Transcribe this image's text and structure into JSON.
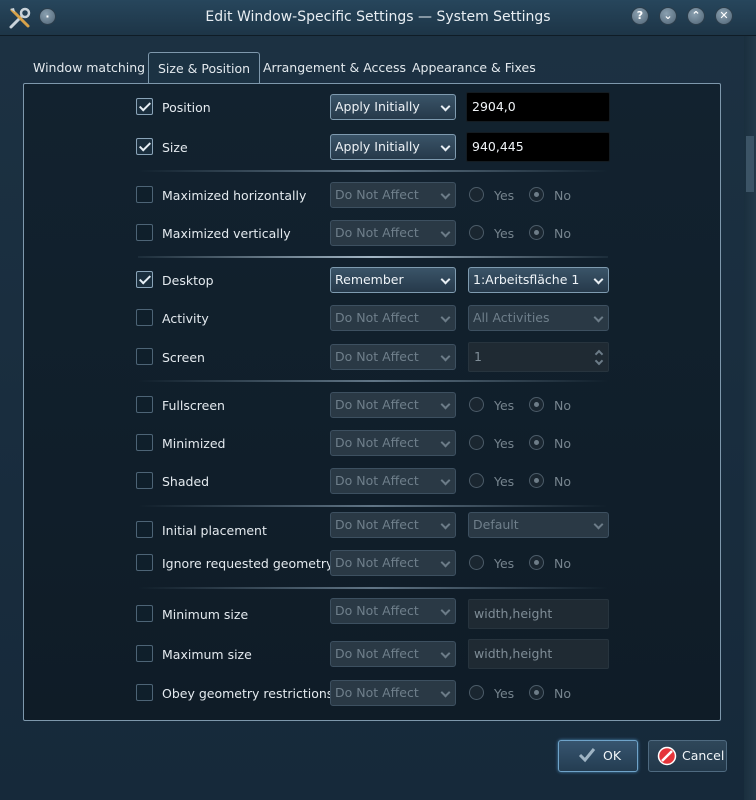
{
  "window": {
    "title": "Edit Window-Specific Settings — System Settings",
    "buttons": [
      "?",
      "⌄",
      "⌃",
      "✕"
    ]
  },
  "tabs": [
    {
      "label": "Window matching",
      "accel": "W",
      "active": false
    },
    {
      "label": "Size & Position",
      "active": true
    },
    {
      "label": "Arrangement & Access",
      "accel": "A",
      "active": false
    },
    {
      "label": "Appearance & Fixes",
      "active": false
    }
  ],
  "rows": {
    "position": {
      "label": "Position",
      "checked": true,
      "policy": "Apply Initially",
      "value": "2904,0"
    },
    "size": {
      "label": "Size",
      "checked": true,
      "policy": "Apply Initially",
      "value": "940,445"
    },
    "max_h": {
      "label": "Maximized horizontally",
      "checked": false,
      "policy": "Do Not Affect",
      "yes": "Yes",
      "no": "No"
    },
    "max_v": {
      "label": "Maximized vertically",
      "checked": false,
      "policy": "Do Not Affect",
      "yes": "Yes",
      "no": "No"
    },
    "desktop": {
      "label": "Desktop",
      "checked": true,
      "policy": "Remember",
      "value": "1:Arbeitsfläche 1"
    },
    "activity": {
      "label": "Activity",
      "checked": false,
      "policy": "Do Not Affect",
      "value": "All Activities"
    },
    "screen": {
      "label": "Screen",
      "checked": false,
      "policy": "Do Not Affect",
      "value": "1"
    },
    "fullscreen": {
      "label": "Fullscreen",
      "checked": false,
      "policy": "Do Not Affect",
      "yes": "Yes",
      "no": "No"
    },
    "minimized": {
      "label": "Minimized",
      "checked": false,
      "policy": "Do Not Affect",
      "yes": "Yes",
      "no": "No"
    },
    "shaded": {
      "label": "Shaded",
      "checked": false,
      "policy": "Do Not Affect",
      "yes": "Yes",
      "no": "No"
    },
    "initial_placement": {
      "label": "Initial placement",
      "checked": false,
      "policy": "Do Not Affect",
      "value": "Default"
    },
    "ignore_geometry": {
      "label": "Ignore requested geometry",
      "checked": false,
      "policy": "Do Not Affect",
      "yes": "Yes",
      "no": "No"
    },
    "min_size": {
      "label": "Minimum size",
      "checked": false,
      "policy": "Do Not Affect",
      "value": "width,height"
    },
    "max_size": {
      "label": "Maximum size",
      "checked": false,
      "policy": "Do Not Affect",
      "value": "width,height"
    },
    "obey_geometry": {
      "label": "Obey geometry restrictions",
      "checked": false,
      "policy": "Do Not Affect",
      "yes": "Yes",
      "no": "No"
    }
  },
  "buttons": {
    "ok": "OK",
    "cancel": "Cancel"
  },
  "colors": {
    "background": "#1a2c3a",
    "panel": "#12222f",
    "accent_border": "#7e98ac"
  }
}
